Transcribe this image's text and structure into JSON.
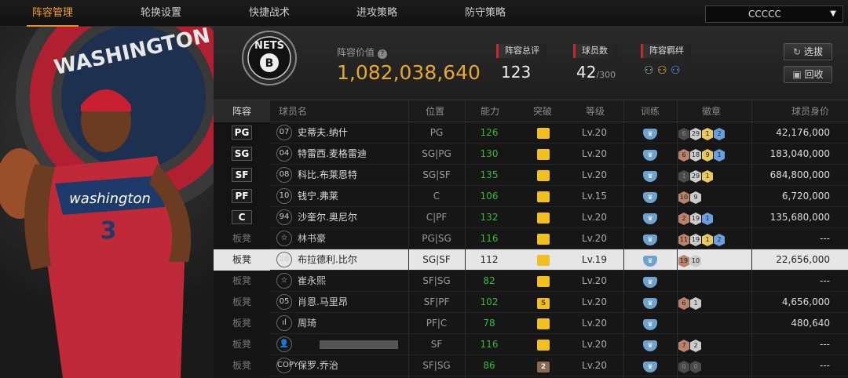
{
  "tabs": [
    "阵容管理",
    "轮换设置",
    "快捷战术",
    "进攻策略",
    "防守策略"
  ],
  "dropdown": {
    "value": "CCCCC"
  },
  "team": {
    "logo_text": "NETS",
    "player_art_text": "WASHINGTON",
    "jersey_text": "washington",
    "jersey_number": "3"
  },
  "header": {
    "value_label": "阵容价值",
    "value": "1,082,038,640",
    "rating_label": "阵容总评",
    "rating": "123",
    "players_label": "球员数",
    "players": "42",
    "players_max": "/300",
    "bond_label": "阵容羁绊",
    "btn_select": "选拔",
    "btn_recycle": "回收",
    "help_icon": "question-icon"
  },
  "columns": [
    "阵容",
    "球员名",
    "位置",
    "能力",
    "突破",
    "等级",
    "训练",
    "徽章",
    "球员身价"
  ],
  "rows": [
    {
      "slot": "PG",
      "starter": true,
      "num": "07",
      "name": "史蒂夫.纳什",
      "pos": "PG",
      "ability": "126",
      "break": "",
      "lv": "Lv.20",
      "badges": [
        [
          "dk",
          "6"
        ],
        [
          "sv",
          "29"
        ],
        [
          "gd",
          "1"
        ],
        [
          "bl",
          "2"
        ]
      ],
      "salary": "42,176,000"
    },
    {
      "slot": "SG",
      "starter": true,
      "num": "04",
      "name": "特雷西.麦格雷迪",
      "pos": "SG|PG",
      "ability": "130",
      "break": "",
      "lv": "Lv.20",
      "badges": [
        [
          "bz",
          "6"
        ],
        [
          "sv",
          "18"
        ],
        [
          "gd",
          "9"
        ],
        [
          "bl",
          "1"
        ]
      ],
      "salary": "183,040,000"
    },
    {
      "slot": "SF",
      "starter": true,
      "num": "08",
      "name": "科比.布莱恩特",
      "pos": "SG|SF",
      "ability": "135",
      "break": "",
      "lv": "Lv.20",
      "badges": [
        [
          "dk",
          "1"
        ],
        [
          "sv",
          "29"
        ],
        [
          "gd",
          "1"
        ]
      ],
      "salary": "684,800,000"
    },
    {
      "slot": "PF",
      "starter": true,
      "num": "10",
      "name": "钱宁.弗莱",
      "pos": "C",
      "ability": "106",
      "break": "",
      "lv": "Lv.15",
      "badges": [
        [
          "bz",
          "10"
        ],
        [
          "sv",
          "9"
        ]
      ],
      "salary": "6,720,000"
    },
    {
      "slot": "C",
      "starter": true,
      "num": "94",
      "name": "沙奎尔.奥尼尔",
      "pos": "C|PF",
      "ability": "132",
      "break": "",
      "lv": "Lv.20",
      "badges": [
        [
          "bz",
          "2"
        ],
        [
          "sv",
          "19"
        ],
        [
          "bl",
          "1"
        ]
      ],
      "salary": "135,680,000"
    },
    {
      "slot": "板凳",
      "starter": false,
      "num": "☆",
      "name": "林书豪",
      "pos": "PG|SG",
      "ability": "116",
      "break": "",
      "lv": "Lv.20",
      "badges": [
        [
          "bz",
          "11"
        ],
        [
          "sv",
          "19"
        ],
        [
          "gd",
          "1"
        ],
        [
          "bl",
          "2"
        ]
      ],
      "salary": "---"
    },
    {
      "slot": "板凳",
      "starter": false,
      "sel": true,
      "num": "16",
      "name": "布拉德利.比尔",
      "pos": "SG|SF",
      "ability": "112",
      "break": "",
      "lv": "Lv.19",
      "badges": [
        [
          "bz",
          "19"
        ],
        [
          "sv",
          "10"
        ]
      ],
      "salary": "22,656,000"
    },
    {
      "slot": "板凳",
      "starter": false,
      "num": "☆",
      "name": "崔永熙",
      "pos": "SF|SG",
      "ability": "82",
      "break": "",
      "lv": "Lv.20",
      "badges": [],
      "salary": "---"
    },
    {
      "slot": "板凳",
      "starter": false,
      "num": "05",
      "name": "肖恩.马里昂",
      "pos": "SF|PF",
      "ability": "102",
      "break": "5",
      "lv": "Lv.20",
      "badges": [
        [
          "bz",
          "6"
        ],
        [
          "sv",
          "1"
        ]
      ],
      "salary": "4,656,000"
    },
    {
      "slot": "板凳",
      "starter": false,
      "num": "ıl",
      "name": "周琦",
      "pos": "PF|C",
      "ability": "78",
      "break": "",
      "lv": "Lv.20",
      "badges": [],
      "salary": "480,640"
    },
    {
      "slot": "板凳",
      "starter": false,
      "num": "👤",
      "name": "",
      "pos": "SF",
      "ability": "116",
      "break": "",
      "lv": "Lv.20",
      "badges": [
        [
          "bz",
          "7"
        ],
        [
          "sv",
          "2"
        ]
      ],
      "salary": "---"
    },
    {
      "slot": "板凳",
      "starter": false,
      "num": "COPY",
      "name": "保罗.乔治",
      "pos": "SF|SG",
      "ability": "86",
      "break": "2",
      "lv": "Lv.20",
      "badges": [
        [
          "dk",
          "0"
        ],
        [
          "dk",
          "0"
        ]
      ],
      "salary": "---"
    }
  ]
}
